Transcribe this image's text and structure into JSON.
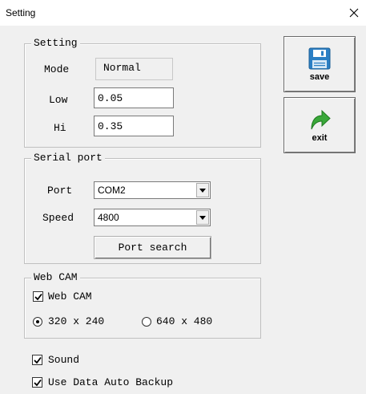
{
  "window": {
    "title": "Setting",
    "close_icon": "close-icon"
  },
  "setting_group": {
    "legend": "Setting",
    "mode_label": "Mode",
    "mode_value": "Normal",
    "low_label": "Low",
    "low_value": "0.05",
    "hi_label": "Hi",
    "hi_value": "0.35"
  },
  "serial_group": {
    "legend": "Serial port",
    "port_label": "Port",
    "port_value": "COM2",
    "speed_label": "Speed",
    "speed_value": "4800",
    "port_search_label": "Port search"
  },
  "webcam_group": {
    "legend": "Web CAM",
    "webcam_checkbox_label": "Web CAM",
    "webcam_checked": true,
    "res_option_1": "320 x 240",
    "res_option_2": "640 x 480",
    "selected_resolution": "320 x 240"
  },
  "options": {
    "sound_label": "Sound",
    "sound_checked": true,
    "backup_label": "Use Data Auto Backup",
    "backup_checked": true
  },
  "side_buttons": {
    "save_label": "save",
    "save_icon": "floppy-disk-icon",
    "exit_label": "exit",
    "exit_icon": "green-arrow-icon"
  },
  "colors": {
    "window_bg": "#f0f0f0",
    "save_icon_color": "#2b7fc4",
    "exit_icon_color": "#3aa83a"
  }
}
